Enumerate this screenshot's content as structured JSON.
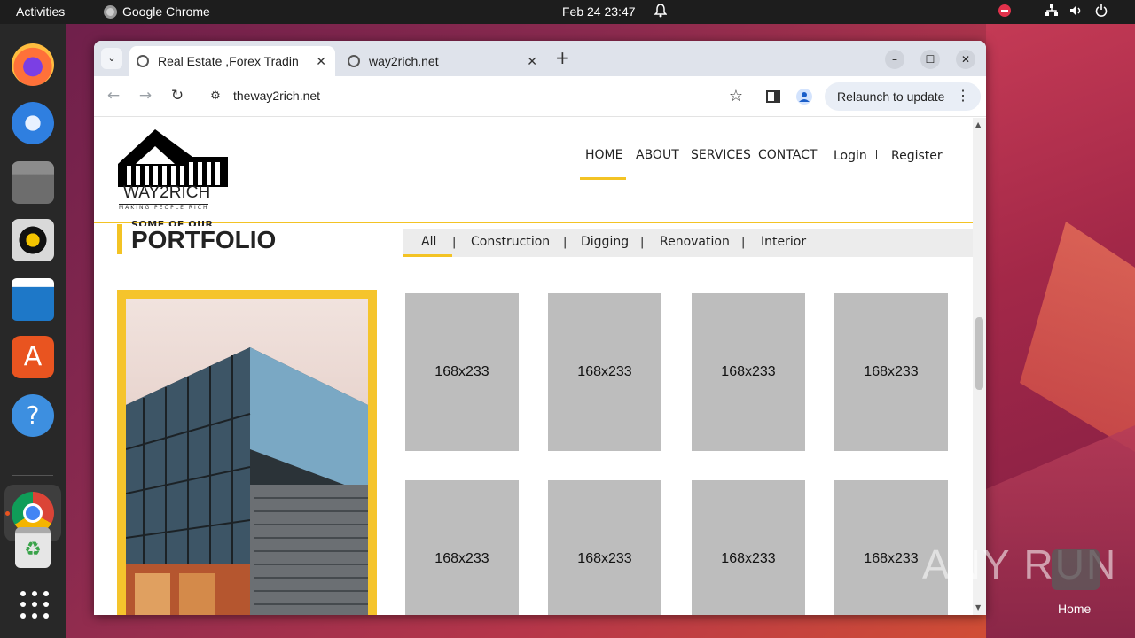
{
  "system": {
    "activities": "Activities",
    "app_name": "Google Chrome",
    "clock": "Feb 24  23:47"
  },
  "browser": {
    "tabs": [
      {
        "title": "Real Estate ,Forex Tradin",
        "active": true
      },
      {
        "title": "way2rich.net",
        "active": false
      }
    ],
    "new_tab": "+",
    "url": "theway2rich.net",
    "relaunch_label": "Relaunch to update"
  },
  "site": {
    "logo": {
      "brand": "WAY2RICH",
      "tagline": "MAKING PEOPLE RICH"
    },
    "nav": [
      {
        "label": "HOME",
        "active": true
      },
      {
        "label": "ABOUT"
      },
      {
        "label": "SERVICES"
      },
      {
        "label": "CONTACT"
      }
    ],
    "auth": {
      "login": "Login",
      "register": "Register"
    },
    "portfolio": {
      "subtitle": "SOME OF OUR",
      "title": "PORTFOLIO",
      "filters": [
        "All",
        "Construction",
        "Digging",
        "Renovation",
        "Interior"
      ],
      "active_filter": "All",
      "placeholders": [
        "168x233",
        "168x233",
        "168x233",
        "168x233",
        "168x233",
        "168x233",
        "168x233",
        "168x233"
      ]
    }
  },
  "desktop": {
    "watermark": "ANY RUN",
    "home_label": "Home"
  },
  "colors": {
    "accent": "#f3c324",
    "ubuntu_orange": "#e95420"
  }
}
